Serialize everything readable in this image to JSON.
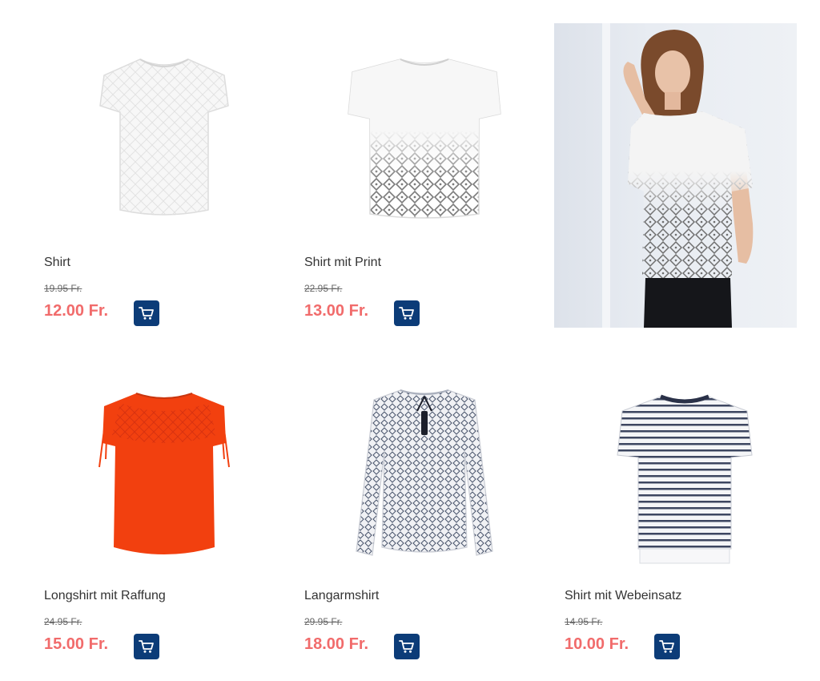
{
  "currency_note": "Fr.",
  "products": [
    {
      "name": "Shirt",
      "old_price": "19.95 Fr.",
      "price": "12.00 Fr.",
      "color": "#f4f4f4"
    },
    {
      "name": "Shirt mit Print",
      "old_price": "22.95 Fr.",
      "price": "13.00 Fr.",
      "color": "#f6f6f6"
    },
    {
      "name": "Longshirt mit Raffung",
      "old_price": "24.95 Fr.",
      "price": "15.00 Fr.",
      "color": "#f03a10"
    },
    {
      "name": "Langarmshirt",
      "old_price": "29.95 Fr.",
      "price": "18.00 Fr.",
      "color": "#e6e8ee"
    },
    {
      "name": "Shirt mit Webeinsatz",
      "old_price": "14.95 Fr.",
      "price": "10.00 Fr.",
      "color": "#e9ebf0"
    }
  ],
  "colors": {
    "price": "#f16b6b",
    "cart_button": "#0c3c78",
    "text": "#333333"
  }
}
